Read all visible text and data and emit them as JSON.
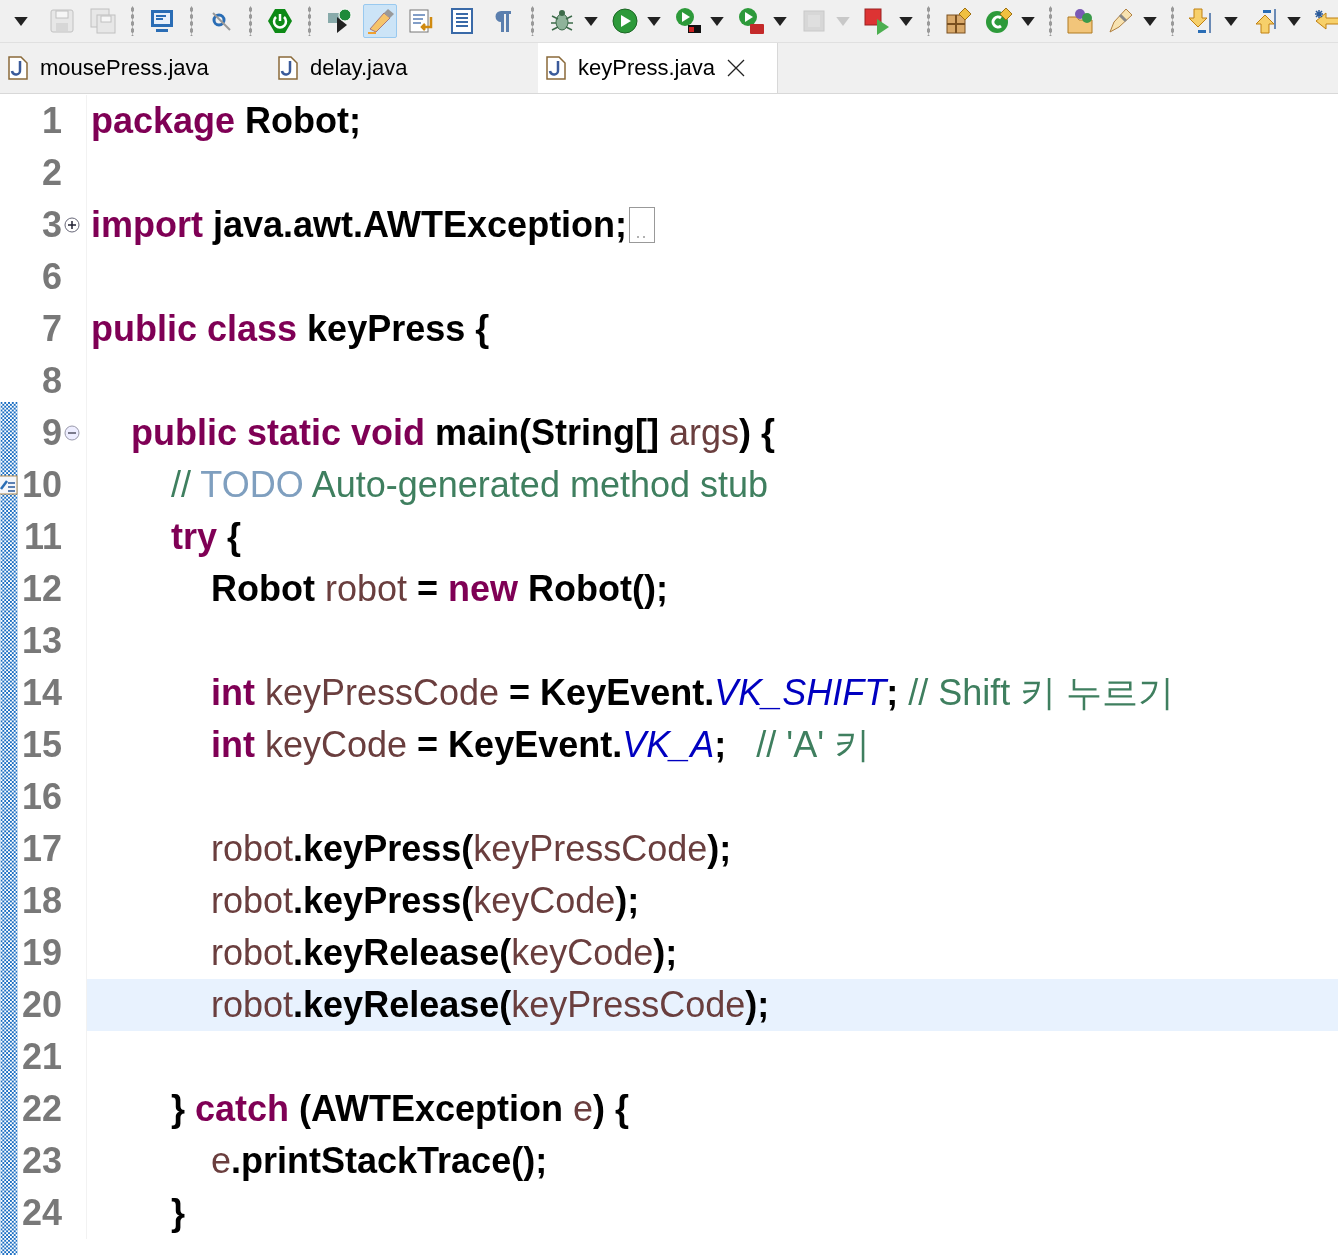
{
  "toolbar": [
    {
      "kind": "view-menu",
      "selected": false,
      "disabled": false,
      "dropdown": false
    },
    {
      "kind": "save",
      "selected": false,
      "disabled": true,
      "dropdown": false
    },
    {
      "kind": "save-all",
      "selected": false,
      "disabled": true,
      "dropdown": false
    },
    {
      "kind": "separator"
    },
    {
      "kind": "console",
      "selected": false,
      "disabled": false,
      "dropdown": false
    },
    {
      "kind": "separator"
    },
    {
      "kind": "search",
      "selected": false,
      "disabled": false,
      "dropdown": false
    },
    {
      "kind": "separator"
    },
    {
      "kind": "power",
      "selected": false,
      "disabled": false,
      "dropdown": false
    },
    {
      "kind": "separator"
    },
    {
      "kind": "run-last",
      "selected": false,
      "disabled": false,
      "dropdown": false
    },
    {
      "kind": "highlight",
      "selected": true,
      "disabled": false,
      "dropdown": false
    },
    {
      "kind": "format",
      "selected": false,
      "disabled": false,
      "dropdown": false
    },
    {
      "kind": "block",
      "selected": false,
      "disabled": false,
      "dropdown": false
    },
    {
      "kind": "pilcrow",
      "selected": false,
      "disabled": false,
      "dropdown": false
    },
    {
      "kind": "separator"
    },
    {
      "kind": "debug",
      "selected": false,
      "disabled": false,
      "dropdown": true
    },
    {
      "kind": "run",
      "selected": false,
      "disabled": false,
      "dropdown": true
    },
    {
      "kind": "coverage",
      "selected": false,
      "disabled": false,
      "dropdown": true
    },
    {
      "kind": "external",
      "selected": false,
      "disabled": false,
      "dropdown": true
    },
    {
      "kind": "stop",
      "selected": false,
      "disabled": true,
      "dropdown": true
    },
    {
      "kind": "launch",
      "selected": false,
      "disabled": false,
      "dropdown": true
    },
    {
      "kind": "separator"
    },
    {
      "kind": "new-package",
      "selected": false,
      "disabled": false,
      "dropdown": false
    },
    {
      "kind": "new-class",
      "selected": false,
      "disabled": false,
      "dropdown": true
    },
    {
      "kind": "separator"
    },
    {
      "kind": "open-type",
      "selected": false,
      "disabled": false,
      "dropdown": false
    },
    {
      "kind": "pen",
      "selected": false,
      "disabled": false,
      "dropdown": true
    },
    {
      "kind": "separator"
    },
    {
      "kind": "next-annotation",
      "selected": false,
      "disabled": false,
      "dropdown": true
    },
    {
      "kind": "prev-annotation",
      "selected": false,
      "disabled": false,
      "dropdown": true
    },
    {
      "kind": "back",
      "selected": false,
      "disabled": false,
      "dropdown": false
    }
  ],
  "tabs": [
    {
      "label": "mousePress.java",
      "selected": false
    },
    {
      "label": "delay.java",
      "selected": false
    },
    {
      "label": "keyPress.java",
      "selected": true
    }
  ],
  "editor": {
    "lines": [
      {
        "number": "1",
        "current": false,
        "tokens": [
          {
            "kind": "keyword",
            "text": "package"
          },
          {
            "kind": "plain",
            "text": " Robot;"
          }
        ]
      },
      {
        "number": "2",
        "current": false
      },
      {
        "number": "3",
        "current": false,
        "expanded": false,
        "tokens": [
          {
            "kind": "keyword",
            "text": "import"
          },
          {
            "kind": "plain",
            "text": " java.awt.AWTException;"
          }
        ]
      },
      {
        "number": "6",
        "current": false
      },
      {
        "number": "7",
        "current": false,
        "tokens": [
          {
            "kind": "keyword",
            "text": "public class"
          },
          {
            "kind": "plain",
            "text": " keyPress {"
          }
        ],
        "children": [
          {
            "number": "8",
            "current": false
          },
          {
            "number": "9",
            "current": false,
            "expanded": true,
            "tokens": [
              {
                "kind": "keyword",
                "text": "public static void"
              },
              {
                "kind": "plain",
                "text": " main(String[] "
              },
              {
                "kind": "variable",
                "text": "args"
              },
              {
                "kind": "plain",
                "text": ") {"
              }
            ],
            "children": [
              {
                "number": "10",
                "current": false,
                "task": true,
                "tokens": [
                  {
                    "kind": "comment",
                    "text": "// "
                  },
                  {
                    "kind": "task-tag",
                    "text": "TODO"
                  },
                  {
                    "kind": "comment",
                    "text": " Auto-generated method stub"
                  }
                ]
              },
              {
                "number": "11",
                "current": false,
                "tokens": [
                  {
                    "kind": "keyword",
                    "text": "try"
                  },
                  {
                    "kind": "plain",
                    "text": " {"
                  }
                ],
                "children": [
                  {
                    "number": "12",
                    "current": false,
                    "tokens": [
                      {
                        "kind": "plain",
                        "text": "Robot "
                      },
                      {
                        "kind": "variable",
                        "text": "robot"
                      },
                      {
                        "kind": "plain",
                        "text": " = "
                      },
                      {
                        "kind": "keyword",
                        "text": "new"
                      },
                      {
                        "kind": "plain",
                        "text": " Robot();"
                      }
                    ]
                  },
                  {
                    "number": "13",
                    "current": false
                  },
                  {
                    "number": "14",
                    "current": false,
                    "tokens": [
                      {
                        "kind": "keyword",
                        "text": "int"
                      },
                      {
                        "kind": "variable",
                        "text": " keyPressCode"
                      },
                      {
                        "kind": "plain",
                        "text": " = KeyEvent."
                      },
                      {
                        "kind": "constant",
                        "text": "VK_SHIFT"
                      },
                      {
                        "kind": "plain",
                        "text": "; "
                      },
                      {
                        "kind": "comment",
                        "text": "// Shift 키 누르기"
                      }
                    ]
                  },
                  {
                    "number": "15",
                    "current": false,
                    "tokens": [
                      {
                        "kind": "keyword",
                        "text": "int"
                      },
                      {
                        "kind": "variable",
                        "text": " keyCode"
                      },
                      {
                        "kind": "plain",
                        "text": " = KeyEvent."
                      },
                      {
                        "kind": "constant",
                        "text": "VK_A"
                      },
                      {
                        "kind": "plain",
                        "text": ";   "
                      },
                      {
                        "kind": "comment",
                        "text": "// 'A' 키"
                      }
                    ]
                  },
                  {
                    "number": "16",
                    "current": false
                  },
                  {
                    "number": "17",
                    "current": false,
                    "tokens": [
                      {
                        "kind": "variable",
                        "text": "robot"
                      },
                      {
                        "kind": "plain",
                        "text": ".keyPress("
                      },
                      {
                        "kind": "variable",
                        "text": "keyPressCode"
                      },
                      {
                        "kind": "plain",
                        "text": ");"
                      }
                    ]
                  },
                  {
                    "number": "18",
                    "current": false,
                    "tokens": [
                      {
                        "kind": "variable",
                        "text": "robot"
                      },
                      {
                        "kind": "plain",
                        "text": ".keyPress("
                      },
                      {
                        "kind": "variable",
                        "text": "keyCode"
                      },
                      {
                        "kind": "plain",
                        "text": ");"
                      }
                    ]
                  },
                  {
                    "number": "19",
                    "current": false,
                    "tokens": [
                      {
                        "kind": "variable",
                        "text": "robot"
                      },
                      {
                        "kind": "plain",
                        "text": ".keyRelease("
                      },
                      {
                        "kind": "variable",
                        "text": "keyCode"
                      },
                      {
                        "kind": "plain",
                        "text": ");"
                      }
                    ]
                  },
                  {
                    "number": "20",
                    "current": true,
                    "tokens": [
                      {
                        "kind": "variable",
                        "text": "robot"
                      },
                      {
                        "kind": "plain",
                        "text": ".keyRelease("
                      },
                      {
                        "kind": "variable",
                        "text": "keyPressCode"
                      },
                      {
                        "kind": "plain",
                        "text": ");"
                      }
                    ]
                  },
                  {
                    "number": "21",
                    "current": false
                  }
                ]
              },
              {
                "number": "22",
                "current": false,
                "tokens": [
                  {
                    "kind": "plain",
                    "text": "} "
                  },
                  {
                    "kind": "keyword",
                    "text": "catch"
                  },
                  {
                    "kind": "plain",
                    "text": " (AWTException "
                  },
                  {
                    "kind": "variable",
                    "text": "e"
                  },
                  {
                    "kind": "plain",
                    "text": ") {"
                  }
                ],
                "children": [
                  {
                    "number": "23",
                    "current": false,
                    "tokens": [
                      {
                        "kind": "variable",
                        "text": "e"
                      },
                      {
                        "kind": "plain",
                        "text": ".printStackTrace();"
                      }
                    ]
                  }
                ]
              },
              {
                "number": "24",
                "current": false,
                "tokens": [
                  {
                    "kind": "plain",
                    "text": "}"
                  }
                ]
              }
            ]
          }
        ]
      }
    ]
  }
}
